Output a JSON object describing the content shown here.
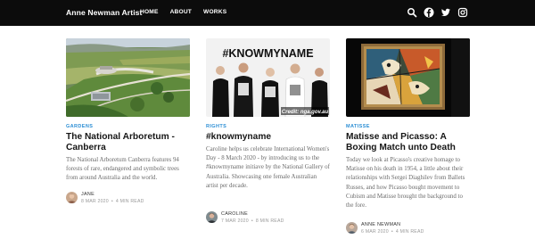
{
  "site": {
    "brand": "Anne Newman Artist"
  },
  "nav": {
    "links": [
      "HOME",
      "ABOUT",
      "WORKS"
    ],
    "icons": [
      "search-icon",
      "facebook-icon",
      "twitter-icon",
      "instagram-icon"
    ]
  },
  "colors": {
    "navbar": "#0c0c0c",
    "category": "#2d8fd5",
    "excerpt": "#6b6b6b"
  },
  "posts": [
    {
      "category": "GARDENS",
      "title": "The National Arboretum - Canberra",
      "excerpt": "The National Arboretum Canberra features 94 forests of rare, endangered and symbolic trees from around Australia and the world.",
      "author": "JANE",
      "date": "8 MAR 2020",
      "read": "4 MIN READ"
    },
    {
      "category": "RIGHTS",
      "title": "#knowmyname",
      "excerpt": "Caroline helps us celebrate International Women's Day - 8 March 2020 - by introducing us to the #knowmyname initiave by the National Gallery of Australia. Showcasing one female Australian artist per decade.",
      "image_text": {
        "headline": "#KNOWMYNAME",
        "credit": "Credit: nga.gov.au"
      },
      "author": "CAROLINE",
      "date": "7 MAR 2020",
      "read": "8 MIN READ"
    },
    {
      "category": "MATISSE",
      "title": "Matisse and Picasso: A Boxing Match unto Death",
      "excerpt": "Today we look at Picasso's creative homage to Matisse on his death in 1954, a little about their relationships with Sergei Diaghilev from Ballets Russes, and how Picasso bought movement to Cubism and Matisse brought the background to the fore.",
      "author": "ANNE NEWMAN",
      "date": "6 MAR 2020",
      "read": "4 MIN READ"
    }
  ]
}
